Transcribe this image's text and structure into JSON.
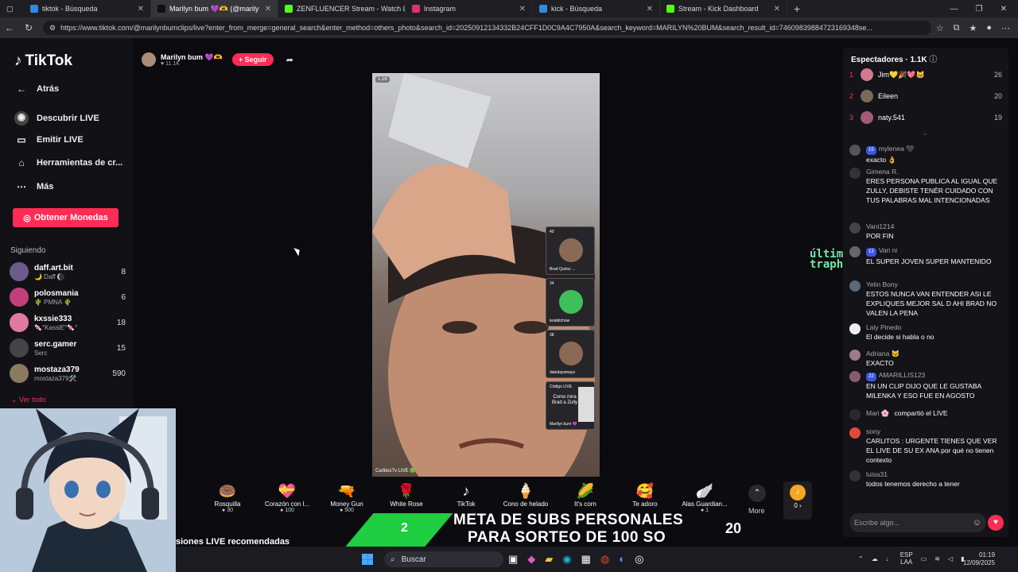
{
  "tabs": [
    {
      "title": "tiktok - Búsqueda",
      "color": "#2e8ae6"
    },
    {
      "title": "Marilyn bum 💜🫶 (@marily",
      "color": "#111111",
      "active": true
    },
    {
      "title": "ZENFLUENCER Stream - Watch L",
      "color": "#53fc18"
    },
    {
      "title": "Instagram",
      "color": "#e1306c"
    },
    {
      "title": "kick - Búsqueda",
      "color": "#2e8ae6"
    },
    {
      "title": "Stream - Kick Dashboard",
      "color": "#53fc18"
    }
  ],
  "url": "https://www.tiktok.com/@marilynbumclips/live?enter_from_merge=general_search&enter_method=others_photo&search_id=20250912134332B24CFF1D0C9A4C7950A&search_keyword=MARILYN%20BUM&search_result_id=74609839884723169348se...",
  "sidebar": {
    "logo": "TikTok",
    "back": "Atrás",
    "nav": [
      "Descubrir LIVE",
      "Emitir LIVE",
      "Herramientas de cr...",
      "Más"
    ],
    "coins_button": "Obtener Monedas",
    "following_title": "Siguiendo",
    "following": [
      {
        "name": "daff.art.bit",
        "sub": "🌙 Daff 🌘",
        "count": "8",
        "color": "#6b5a8a"
      },
      {
        "name": "polosmania",
        "sub": "🌵 PMNA 🌵",
        "count": "6",
        "color": "#c2407a"
      },
      {
        "name": "kxssie333",
        "sub": "🍬°KassiE°🍬°",
        "count": "18",
        "color": "#e07aa0"
      },
      {
        "name": "serc.gamer",
        "sub": "Serc",
        "count": "15",
        "color": "#444444"
      },
      {
        "name": "mostaza379",
        "sub": "mostaza379🛠️",
        "count": "590",
        "color": "#8a7a60"
      }
    ],
    "see_all": "⌄ Ver todo"
  },
  "stream": {
    "host_name": "Marilyn bum 💜🫶",
    "viewers": "11.1K",
    "follow_label": "+ Seguir",
    "video_badge": "1.1K",
    "video_footer": "CarlitosTv LIVE 🟢",
    "guests": [
      {
        "name": "Brad Quiroz ...",
        "count": "40"
      },
      {
        "name": "lerabitchow",
        "count": "34"
      },
      {
        "name": "dalodaysmays",
        "count": "38"
      },
      {
        "name": "Marilyn bum 💜",
        "count": "Código LIVE",
        "caption": "Como mira Brad a Zully"
      }
    ]
  },
  "gifts": [
    {
      "name": "Rosquilla",
      "price": "30",
      "icon": "🍩"
    },
    {
      "name": "Corazón con l...",
      "price": "100",
      "icon": "💝"
    },
    {
      "name": "Money Gun",
      "price": "500",
      "icon": "🔫"
    },
    {
      "name": "White Rose",
      "price": "",
      "icon": "🌹"
    },
    {
      "name": "TikTok",
      "price": "",
      "icon": "♪"
    },
    {
      "name": "Cono de helado",
      "price": "",
      "icon": "🍦"
    },
    {
      "name": "It's corn",
      "price": "",
      "icon": "🌽"
    },
    {
      "name": "Te adoro",
      "price": "",
      "icon": "🥰"
    },
    {
      "name": "Alas Guardian...",
      "price": "1",
      "icon": "🪽"
    }
  ],
  "gifts_more": "More",
  "coin_balance": "0 ›",
  "recommended": "siones LIVE recomendadas",
  "overlay": {
    "goal_line1": "META DE SUBS PERSONALES",
    "goal_line2": "PARA SORTEO DE 100 SO",
    "current": "2",
    "target": "20",
    "neon": "último suscriptor: traphlazan"
  },
  "viewers_panel": {
    "title": "Espectadores · 1.1K",
    "top": [
      {
        "rank": "1",
        "name": "Jim💛🎉💖🐱",
        "score": "26",
        "color": "#d07a90"
      },
      {
        "rank": "2",
        "name": "Eileen",
        "score": "20",
        "color": "#7a6a5a"
      },
      {
        "rank": "3",
        "name": "naty.541",
        "score": "19",
        "color": "#a05a7a"
      }
    ]
  },
  "chat": [
    {
      "name": "mylenea 🖤",
      "level": "15",
      "text": "exacto 👌",
      "color": "#555555"
    },
    {
      "name": "Gimena R.",
      "text": "ERES PERSONA PUBLICA AL IGUAL QUE ZULLY, DEBISTE TENÉR CUIDADO CON TUS PALABRAS MAL INTENCIONADAS",
      "color": "#333333"
    },
    {
      "name": "Vani1214",
      "text": "POR FIN",
      "color": "#444444"
    },
    {
      "name": "Vari ni",
      "level": "13",
      "text": "EL SUPER JOVEN SUPER MANTENIDO",
      "color": "#666666"
    },
    {
      "name": "Yelin Bony",
      "text": "ESTOS NUNCA VAN ENTENDER ASI LE EXPLIQUES MEJOR SAL D AHI BRAD NO VALEN LA PENA",
      "color": "#5a6a7a"
    },
    {
      "name": "Laly Pinedo",
      "text": "El decide si habla o no",
      "color": "#eeeeee"
    },
    {
      "name": "Adriana 🐱",
      "text": "EXACTO",
      "color": "#a07a8a"
    },
    {
      "name": "AMARILLIS123",
      "level": "22",
      "text": "EN UN CLIP DIJO QUE LE GUSTABA MILENKA Y ESO FUE EN AGOSTO",
      "color": "#8a5a6a"
    },
    {
      "name": "Mari 🌸",
      "text": "compartió el LIVE",
      "color": "#2a2a2a",
      "inline": true
    },
    {
      "name": "sony",
      "text": "CARLITOS : URGENTE TIENES QUE VER EL LIVE DE SU EX ANA por qué no tienen contexto",
      "color": "#e04a3a"
    },
    {
      "name": "luisa31",
      "text": "todos tenemos derecho a tener",
      "color": "#333333"
    }
  ],
  "chat_placeholder": "Escribe algo...",
  "taskbar": {
    "search": "Buscar",
    "lang": "ESP",
    "lang2": "LAA",
    "time": "01:19",
    "date": "12/09/2025"
  }
}
